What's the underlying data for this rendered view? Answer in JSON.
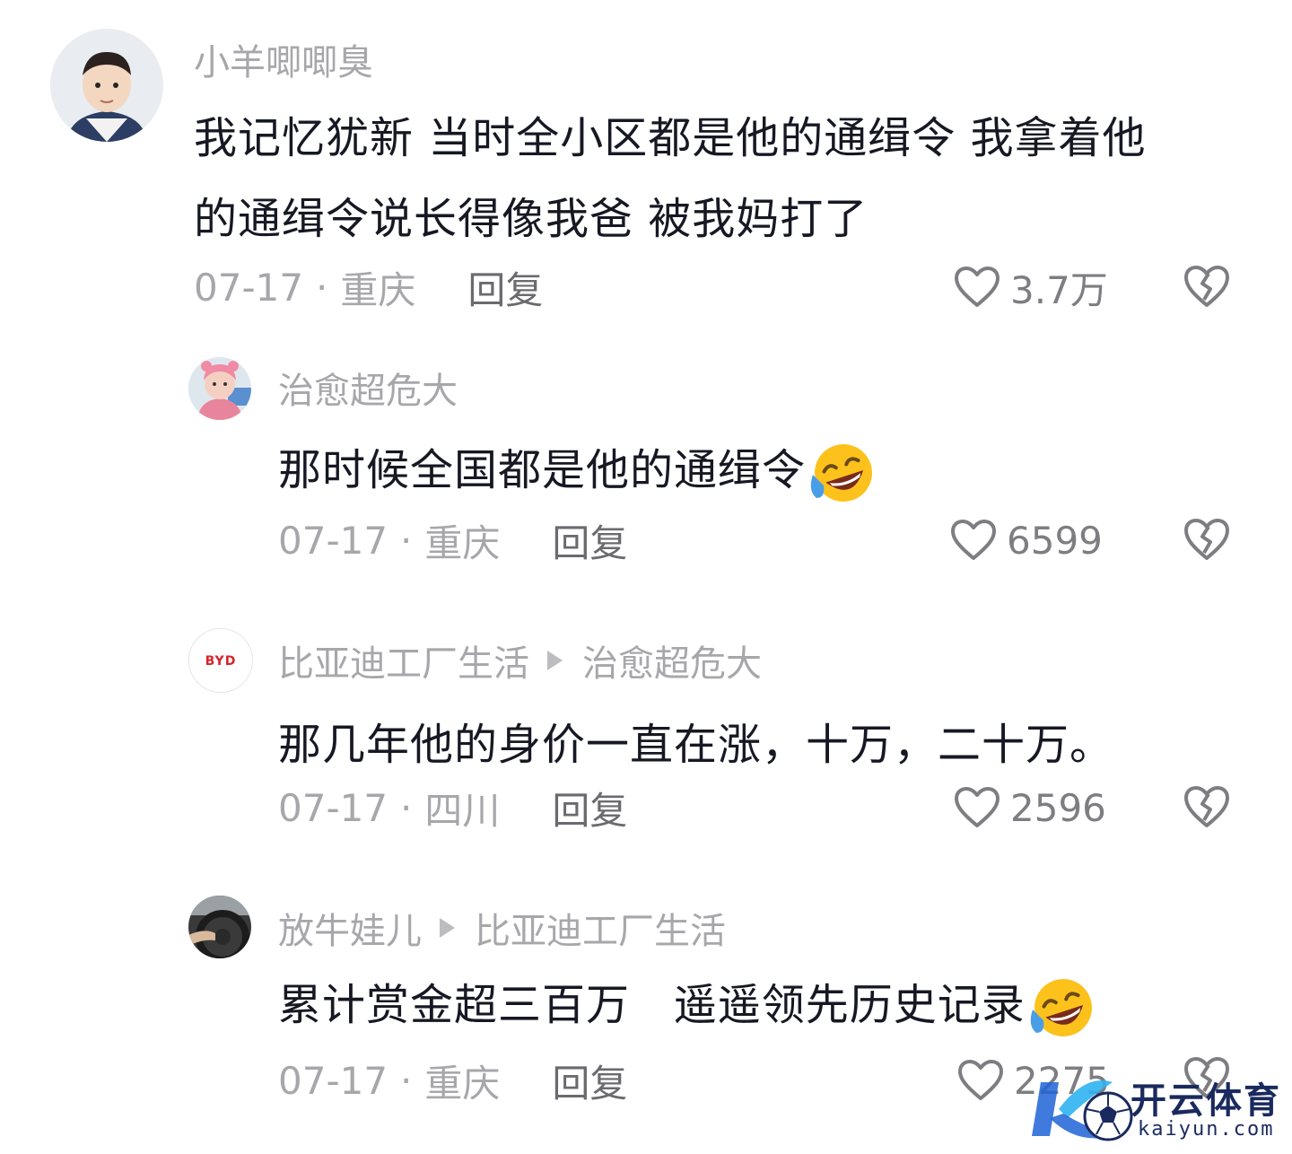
{
  "comments": [
    {
      "username": "小羊唧唧臭",
      "reply_to": "",
      "text_line1": "我记忆犹新 当时全小区都是他的通缉令 我拿着他",
      "text_line2": "的通缉令说长得像我爸 被我妈打了",
      "date": "07-17",
      "location": "重庆",
      "reply_label": "回复",
      "likes": "3.7万"
    },
    {
      "username": "治愈超危大",
      "reply_to": "",
      "text_line1": "那时候全国都是他的通缉令",
      "emoji": "rofl-emoji",
      "date": "07-17",
      "location": "重庆",
      "reply_label": "回复",
      "likes": "6599"
    },
    {
      "username": "比亚迪工厂生活",
      "reply_to": "治愈超危大",
      "avatar_logo": "BYD",
      "text_line1": "那几年他的身价一直在涨，十万，二十万。",
      "date": "07-17",
      "location": "四川",
      "reply_label": "回复",
      "likes": "2596"
    },
    {
      "username": "放牛娃儿",
      "reply_to": "比亚迪工厂生活",
      "text_line1": "累计赏金超三百万   遥遥领先历史记录",
      "emoji": "rofl-emoji",
      "date": "07-17",
      "location": "重庆",
      "reply_label": "回复",
      "likes": "2275"
    }
  ],
  "separator": "·",
  "watermark": {
    "title": "开云体育",
    "subtitle": "kaiyun.com"
  },
  "colors": {
    "text": "#161823",
    "meta": "#a7a7ab",
    "icon": "#7d7d82"
  }
}
